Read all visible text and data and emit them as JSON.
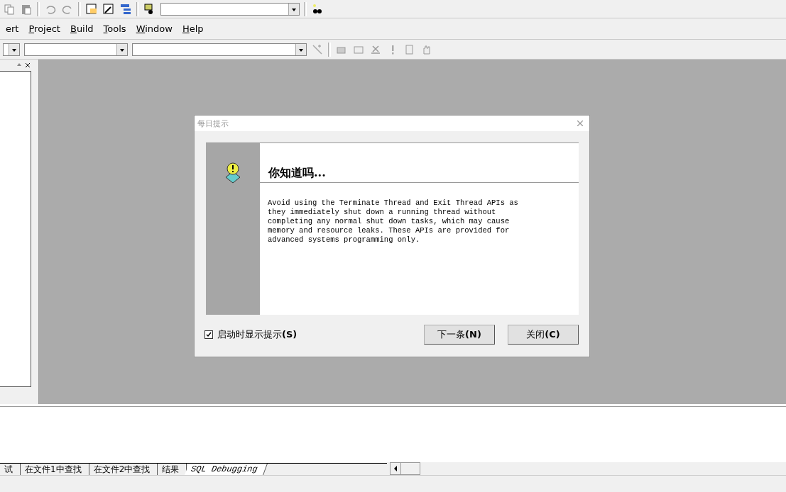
{
  "menu_bar": [
    {
      "label": "ert",
      "mnemonic": false
    },
    {
      "label": "Project",
      "mnemonic": true
    },
    {
      "label": "Build",
      "mnemonic": true
    },
    {
      "label": "Tools",
      "mnemonic": true
    },
    {
      "label": "Window",
      "mnemonic": true
    },
    {
      "label": "Help",
      "mnemonic": true
    }
  ],
  "dialog": {
    "title": "每日提示",
    "heading": "你知道吗...",
    "tip": "Avoid using the Terminate Thread and Exit Thread APIs as\nthey immediately shut down a running thread without\ncompleting any normal shut down tasks, which may cause\nmemory and resource leaks. These APIs are provided for\nadvanced systems programming only.",
    "show_on_startup": {
      "label": "启动时显示提示**(S)**",
      "checked": true
    },
    "buttons": [
      "下一条**(N)**",
      "关闭**(C)**"
    ]
  },
  "output_tabs": [
    {
      "label": "试",
      "selected": false
    },
    {
      "label": "在文件1中查找",
      "selected": false
    },
    {
      "label": "在文件2中查找",
      "selected": false
    },
    {
      "label": "结果",
      "selected": false
    },
    {
      "label": "SQL Debugging",
      "selected": true
    }
  ]
}
